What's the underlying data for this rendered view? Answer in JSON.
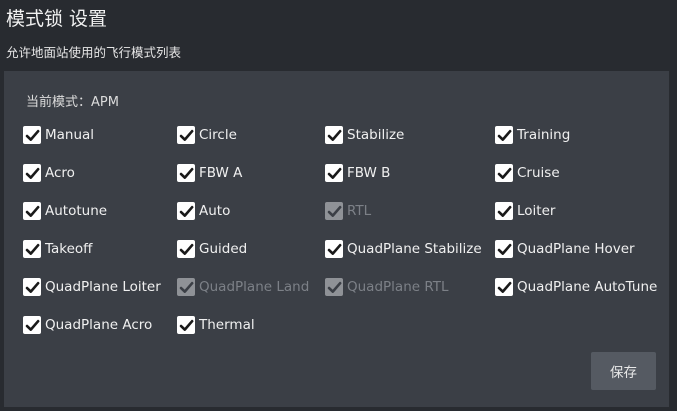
{
  "dialog": {
    "title": "模式锁 设置",
    "subtitle": "允许地面站使用的飞行模式列表",
    "current_mode": "当前模式：APM",
    "save_label": "保存"
  },
  "modes": [
    {
      "label": "Manual",
      "checked": true,
      "enabled": true
    },
    {
      "label": "Circle",
      "checked": true,
      "enabled": true
    },
    {
      "label": "Stabilize",
      "checked": true,
      "enabled": true
    },
    {
      "label": "Training",
      "checked": true,
      "enabled": true
    },
    {
      "label": "Acro",
      "checked": true,
      "enabled": true
    },
    {
      "label": "FBW A",
      "checked": true,
      "enabled": true
    },
    {
      "label": "FBW B",
      "checked": true,
      "enabled": true
    },
    {
      "label": "Cruise",
      "checked": true,
      "enabled": true
    },
    {
      "label": "Autotune",
      "checked": true,
      "enabled": true
    },
    {
      "label": "Auto",
      "checked": true,
      "enabled": true
    },
    {
      "label": "RTL",
      "checked": true,
      "enabled": false
    },
    {
      "label": "Loiter",
      "checked": true,
      "enabled": true
    },
    {
      "label": "Takeoff",
      "checked": true,
      "enabled": true
    },
    {
      "label": "Guided",
      "checked": true,
      "enabled": true
    },
    {
      "label": "QuadPlane Stabilize",
      "checked": true,
      "enabled": true
    },
    {
      "label": "QuadPlane Hover",
      "checked": true,
      "enabled": true
    },
    {
      "label": "QuadPlane Loiter",
      "checked": true,
      "enabled": true
    },
    {
      "label": "QuadPlane Land",
      "checked": true,
      "enabled": false
    },
    {
      "label": "QuadPlane RTL",
      "checked": true,
      "enabled": false
    },
    {
      "label": "QuadPlane AutoTune",
      "checked": true,
      "enabled": true
    },
    {
      "label": "QuadPlane Acro",
      "checked": true,
      "enabled": true
    },
    {
      "label": "Thermal",
      "checked": true,
      "enabled": true
    }
  ],
  "colors": {
    "background": "#282b30",
    "panel": "#3b3f46",
    "checkbox": "#ffffff",
    "check_mark": "#1a1a1a",
    "disabled_checkbox": "#8f9297",
    "disabled_text": "#7c8087",
    "button": "#555a62"
  }
}
